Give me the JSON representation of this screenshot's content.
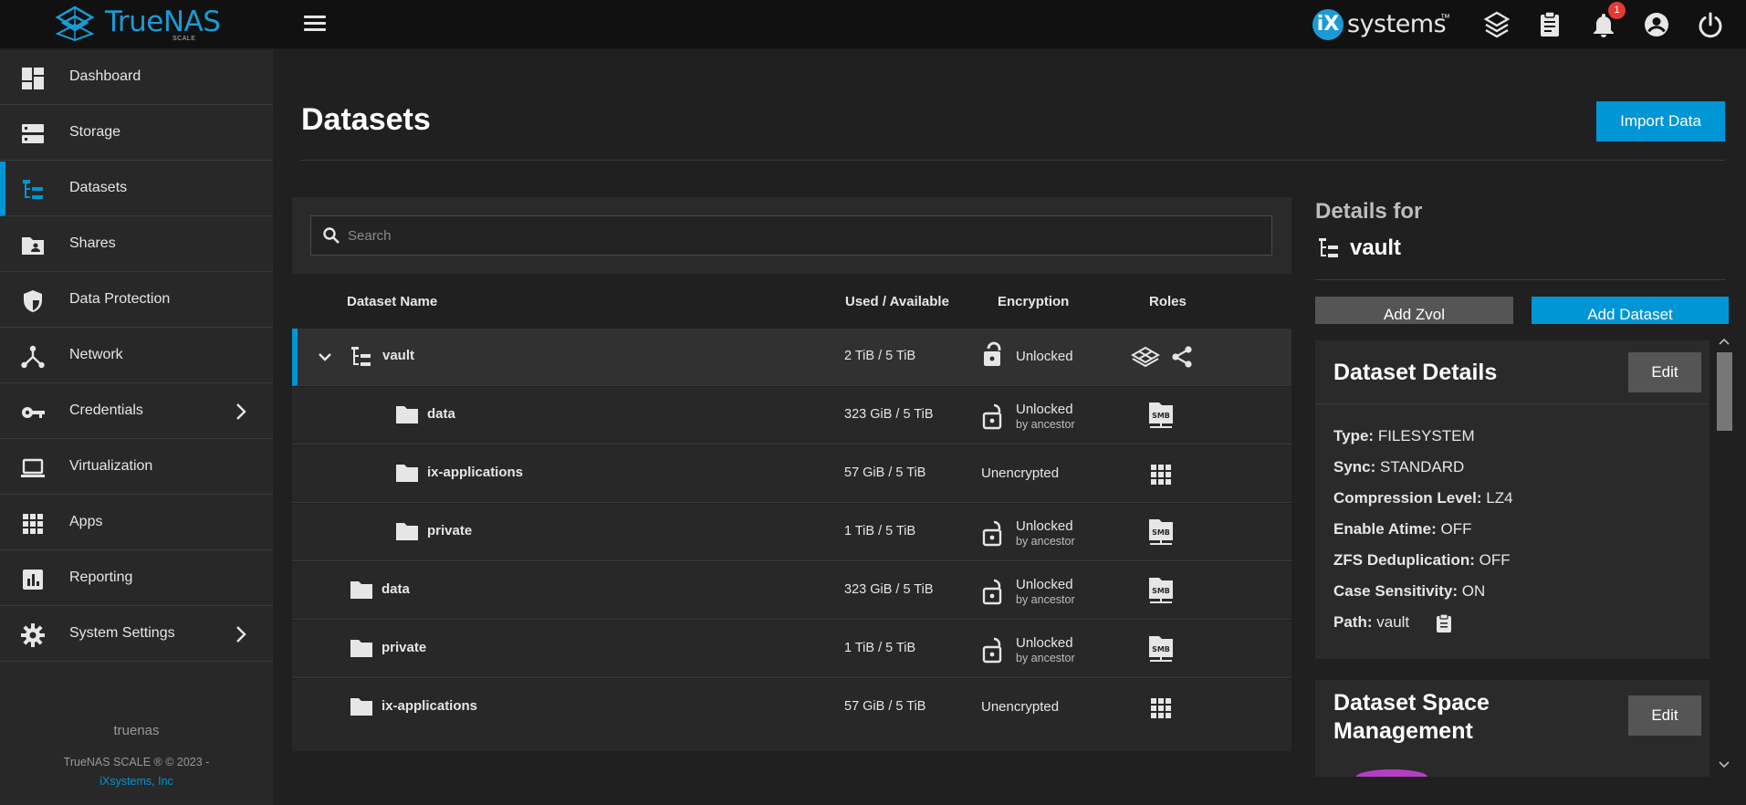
{
  "topbar": {
    "logo_name": "TrueNAS",
    "logo_sub": "SCALE",
    "vendor_brand_prefix": "iX",
    "vendor_brand": "systems",
    "vendor_trademark": "™",
    "notification_count": "1"
  },
  "sidebar": {
    "items": [
      {
        "label": "Dashboard",
        "icon": "dashboard-icon"
      },
      {
        "label": "Storage",
        "icon": "storage-icon"
      },
      {
        "label": "Datasets",
        "icon": "datasets-icon"
      },
      {
        "label": "Shares",
        "icon": "shares-icon"
      },
      {
        "label": "Data Protection",
        "icon": "shield-icon"
      },
      {
        "label": "Network",
        "icon": "network-icon"
      },
      {
        "label": "Credentials",
        "icon": "key-icon"
      },
      {
        "label": "Virtualization",
        "icon": "laptop-icon"
      },
      {
        "label": "Apps",
        "icon": "apps-grid-icon"
      },
      {
        "label": "Reporting",
        "icon": "chart-icon"
      },
      {
        "label": "System Settings",
        "icon": "gear-icon"
      }
    ],
    "active": "Datasets",
    "hostname": "truenas",
    "copyright": "TrueNAS SCALE ® © 2023 -",
    "company_link": "iXsystems, Inc"
  },
  "page": {
    "title": "Datasets",
    "import_button": "Import Data"
  },
  "table": {
    "search_placeholder": "Search",
    "headers": {
      "name": "Dataset Name",
      "used": "Used / Available",
      "encryption": "Encryption",
      "roles": "Roles"
    },
    "rows": [
      {
        "name": "vault",
        "used": "2 TiB / 5 TiB",
        "encryption": "Unlocked",
        "encryption_sub": "",
        "role": "apps-and-share"
      },
      {
        "name": "data",
        "used": "323 GiB / 5 TiB",
        "encryption": "Unlocked",
        "encryption_sub": "by ancestor",
        "role": "smb-share"
      },
      {
        "name": "ix-applications",
        "used": "57 GiB / 5 TiB",
        "encryption": "Unencrypted",
        "encryption_sub": "",
        "role": "apps-grid"
      },
      {
        "name": "private",
        "used": "1 TiB / 5 TiB",
        "encryption": "Unlocked",
        "encryption_sub": "by ancestor",
        "role": "smb-share"
      },
      {
        "name": "data",
        "used": "323 GiB / 5 TiB",
        "encryption": "Unlocked",
        "encryption_sub": "by ancestor",
        "role": "smb-share"
      },
      {
        "name": "private",
        "used": "1 TiB / 5 TiB",
        "encryption": "Unlocked",
        "encryption_sub": "by ancestor",
        "role": "smb-share"
      },
      {
        "name": "ix-applications",
        "used": "57 GiB / 5 TiB",
        "encryption": "Unencrypted",
        "encryption_sub": "",
        "role": "apps-grid"
      }
    ]
  },
  "details": {
    "heading": "Details for",
    "dataset": "vault",
    "add_zvol": "Add Zvol",
    "add_dataset": "Add Dataset",
    "card1": {
      "title": "Dataset Details",
      "edit": "Edit",
      "props": [
        {
          "key": "Type:",
          "value": "FILESYSTEM"
        },
        {
          "key": "Sync:",
          "value": "STANDARD"
        },
        {
          "key": "Compression Level:",
          "value": "LZ4"
        },
        {
          "key": "Enable Atime:",
          "value": "OFF"
        },
        {
          "key": "ZFS Deduplication:",
          "value": "OFF"
        },
        {
          "key": "Case Sensitivity:",
          "value": "ON"
        },
        {
          "key": "Path:",
          "value": "vault"
        }
      ]
    },
    "card2": {
      "title_line1": "Dataset Space",
      "title_line2": "Management",
      "edit": "Edit"
    }
  },
  "colors": {
    "accent": "#0095d5",
    "topbar": "#111111",
    "sidebar": "#282828",
    "background": "#202020",
    "badge": "#e53935"
  }
}
